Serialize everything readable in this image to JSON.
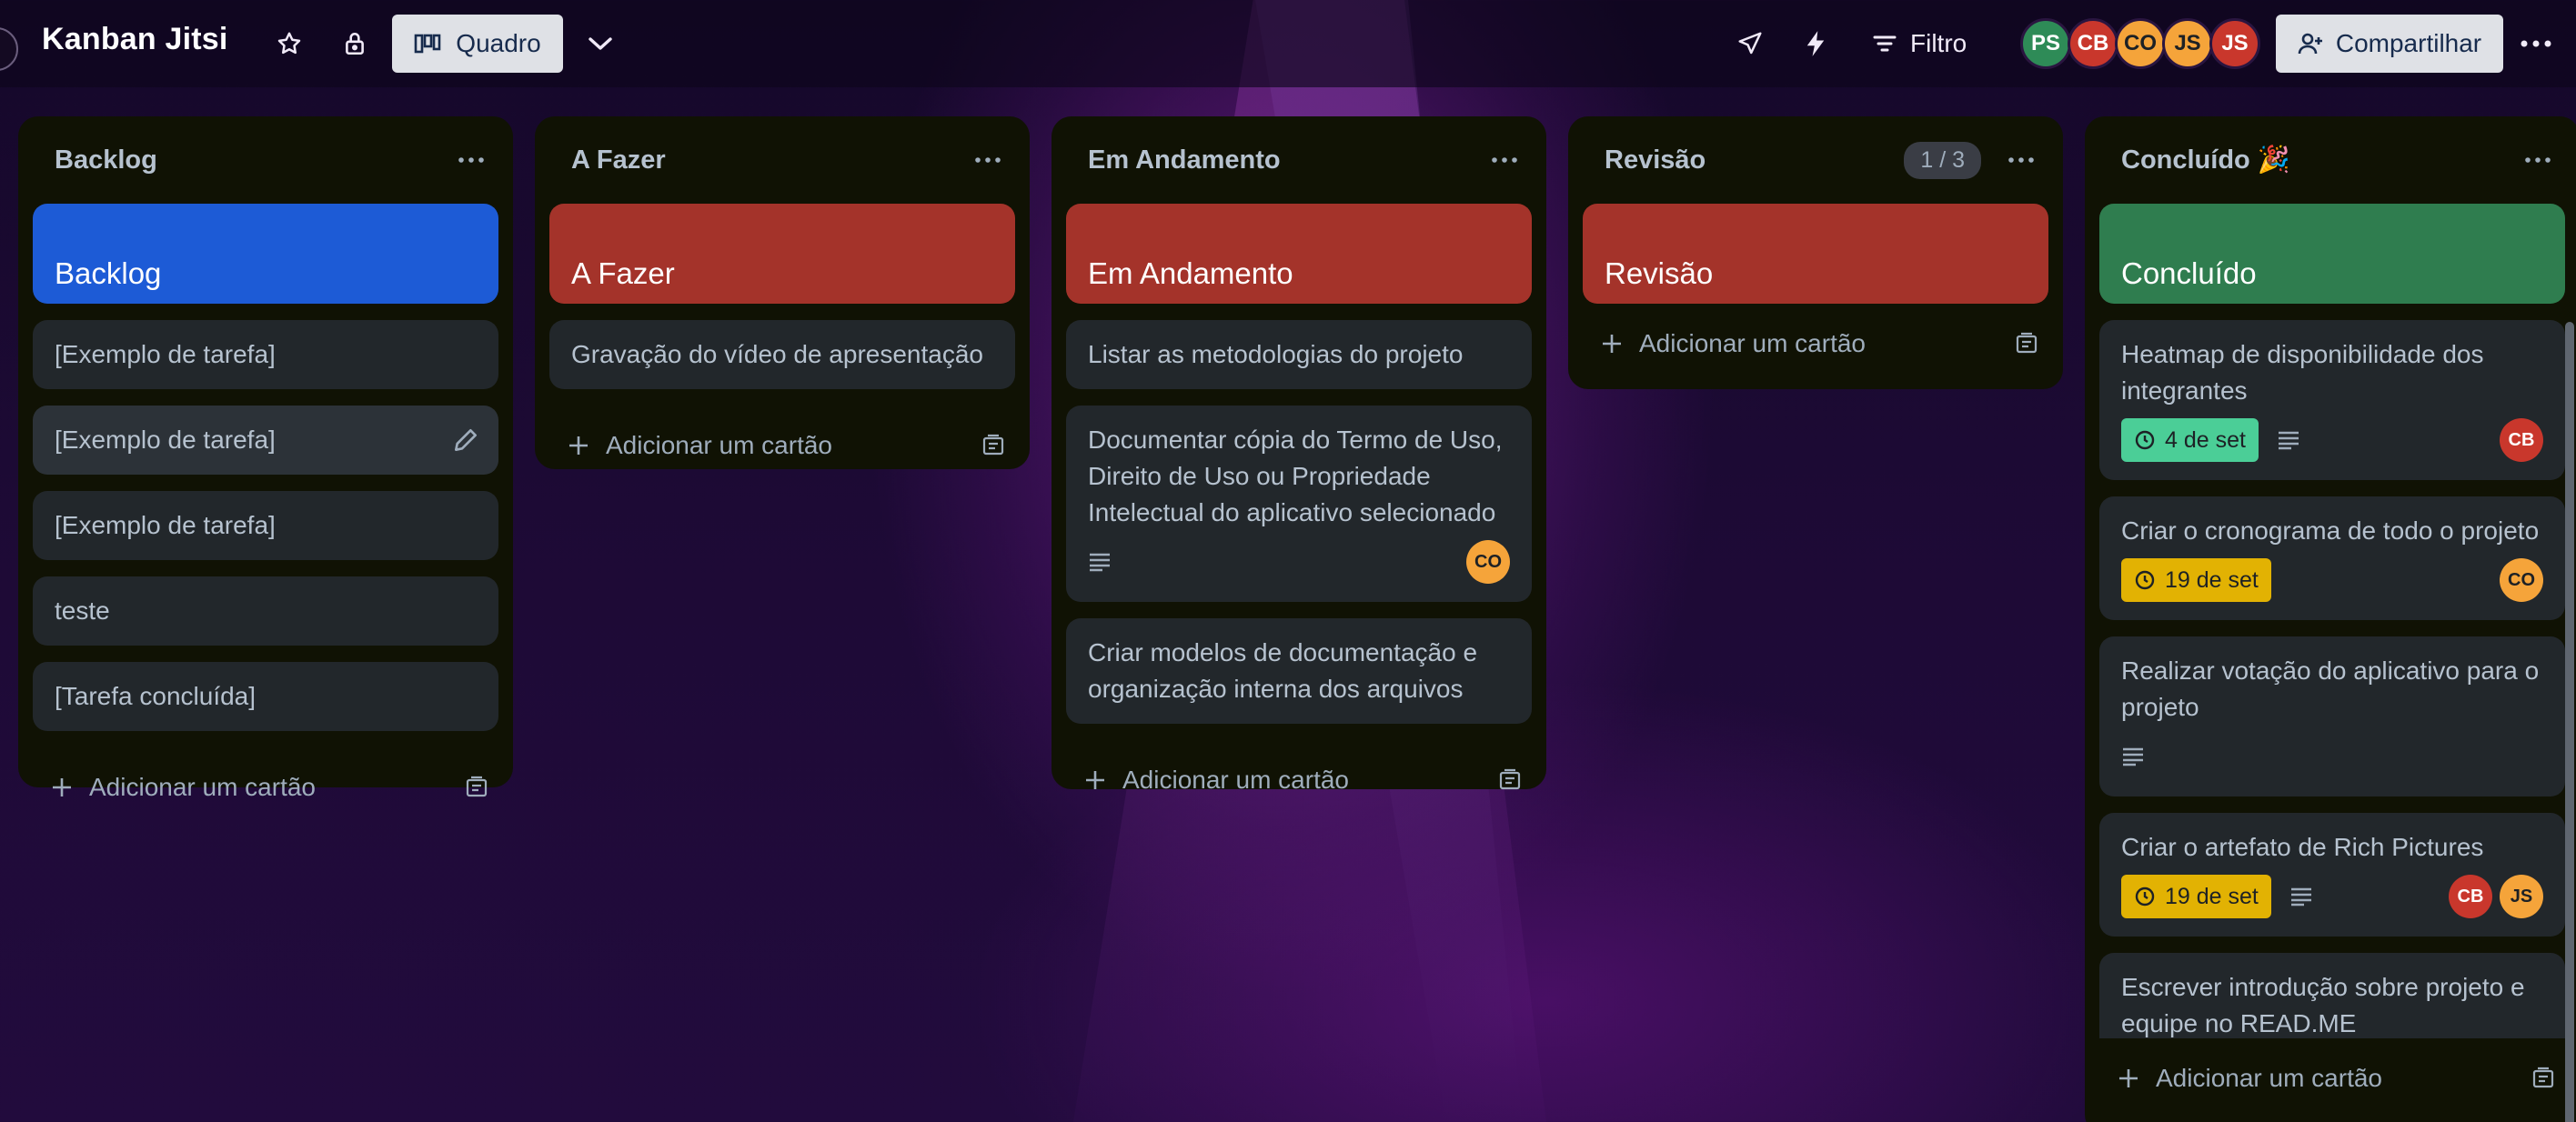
{
  "header": {
    "board_title": "Kanban Jitsi",
    "view_label": "Quadro",
    "filter_label": "Filtro",
    "share_label": "Compartilhar",
    "members": [
      {
        "initials": "PS",
        "color": "#2e8b57"
      },
      {
        "initials": "CB",
        "color": "#c9372c"
      },
      {
        "initials": "CO",
        "color": "#f5a43a"
      },
      {
        "initials": "JS",
        "color": "#f5a43a"
      },
      {
        "initials": "JS",
        "color": "#c9372c"
      }
    ]
  },
  "lists": [
    {
      "title": "Backlog",
      "cover_title": "Backlog",
      "cover_color": "#1d5bd6",
      "cards": [
        "[Exemplo de tarefa]",
        "[Exemplo de tarefa]",
        "[Exemplo de tarefa]",
        "teste",
        "[Tarefa concluída]"
      ],
      "add_label": "Adicionar um cartão"
    },
    {
      "title": "A Fazer",
      "cover_title": "A Fazer",
      "cover_color": "#a4332a",
      "cards": [
        "Gravação do vídeo de apresentação"
      ],
      "add_label": "Adicionar um cartão"
    },
    {
      "title": "Em Andamento",
      "cover_title": "Em Andamento",
      "cover_color": "#a4332a",
      "cards": [
        "Listar as metodologias do projeto",
        "Documentar cópia do Termo de Uso, Direito de Uso ou Propriedade Intelectual do aplicativo selecionado",
        "Criar modelos de documentação e organização interna dos arquivos"
      ],
      "card2_member": "CO",
      "add_label": "Adicionar um cartão"
    },
    {
      "title": "Revisão",
      "count": "1 / 3",
      "cover_title": "Revisão",
      "cover_color": "#a4332a",
      "add_label": "Adicionar um cartão"
    },
    {
      "title": "Concluído 🎉",
      "cover_title": "Concluído",
      "cover_color": "#2f7d4f",
      "cards": [
        {
          "title": "Heatmap de disponibilidade dos integrantes",
          "date": "4 de set",
          "members": [
            "CB"
          ]
        },
        {
          "title": "Criar o cronograma de todo o projeto",
          "date": "19 de set",
          "members": [
            "CO"
          ]
        },
        {
          "title": "Realizar votação do aplicativo para o projeto"
        },
        {
          "title": "Criar o artefato de Rich Pictures",
          "date": "19 de set",
          "members": [
            "CB",
            "JS"
          ]
        },
        {
          "title": "Escrever introdução sobre projeto e equipe no READ.ME"
        }
      ],
      "add_label": "Adicionar um cartão"
    }
  ]
}
